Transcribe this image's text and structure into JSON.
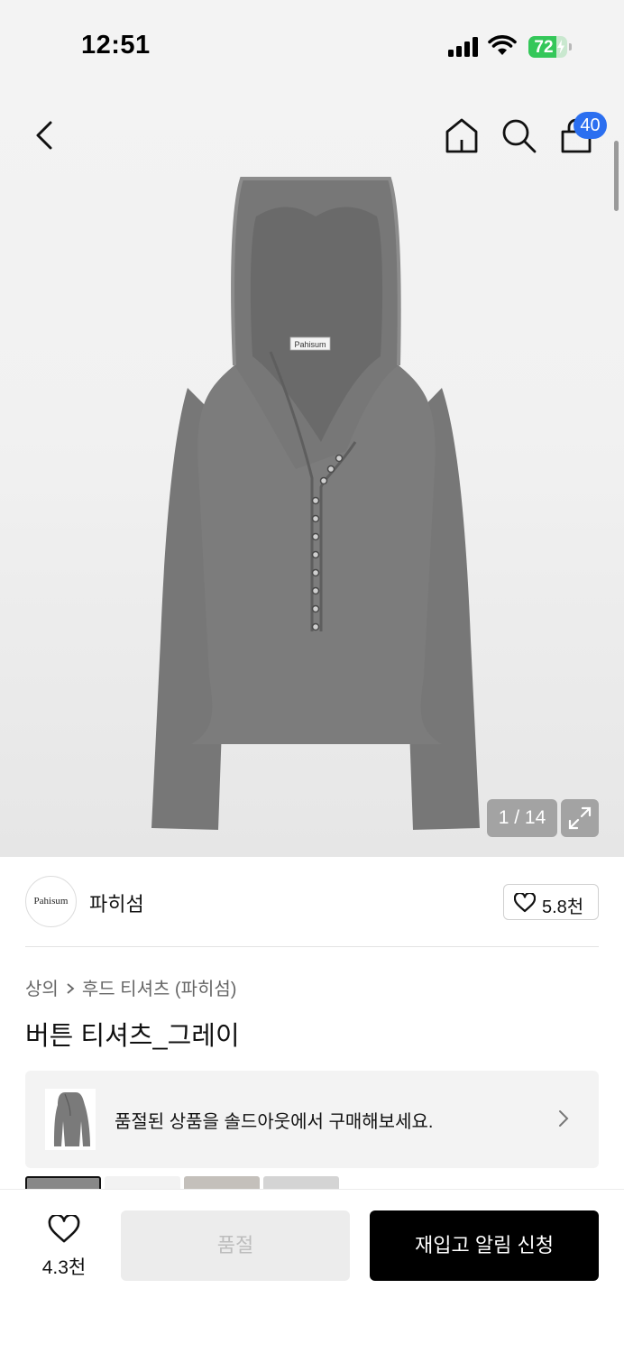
{
  "status_bar": {
    "time": "12:51",
    "battery_percent": "72",
    "battery_level": 0.72
  },
  "header": {
    "cart_badge": "40"
  },
  "gallery": {
    "counter": "1 / 14",
    "label_tag": "Pahisum",
    "colors": {
      "garment": "#7a7a7a",
      "garment_dark": "#5e5e5e"
    }
  },
  "brand": {
    "logo_text": "Pahisum",
    "name": "파히섬",
    "like_count": "5.8천"
  },
  "breadcrumb": {
    "category": "상의",
    "subcategory": "후드 티셔츠 (파히섬)"
  },
  "product": {
    "title": "버튼 티셔츠_그레이"
  },
  "sold_out_banner": {
    "text": "품절된 상품을 솔드아웃에서 구매해보세요."
  },
  "bottom_bar": {
    "wish_count": "4.3천",
    "soldout_label": "품절",
    "restock_label": "재입고 알림 신청"
  },
  "colors": {
    "accent": "#2b6ff0",
    "battery": "#34c759",
    "primary_button": "#000000"
  }
}
